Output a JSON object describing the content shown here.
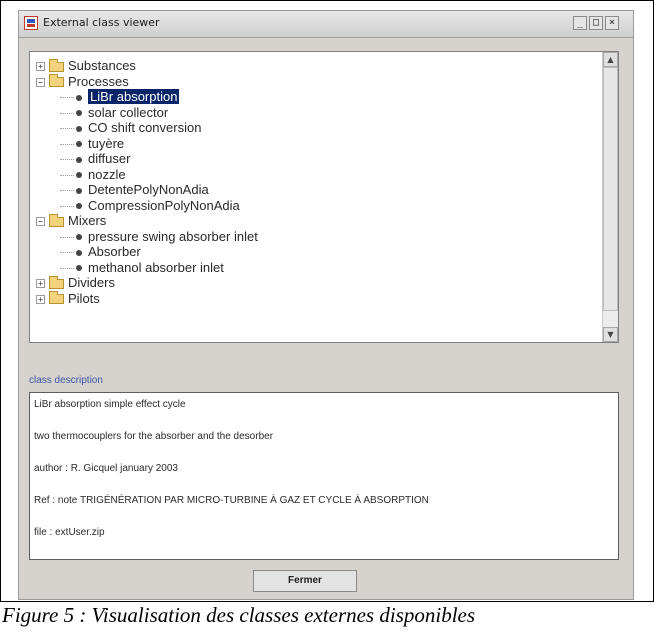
{
  "window": {
    "title": "External class viewer",
    "controls": {
      "minimize": "_",
      "maximize": "□",
      "close": "×"
    }
  },
  "tree": {
    "groups": [
      {
        "label": "Substances",
        "expanded": false,
        "expander": "+"
      },
      {
        "label": "Processes",
        "expanded": true,
        "expander": "−"
      },
      {
        "label": "Mixers",
        "expanded": true,
        "expander": "−"
      },
      {
        "label": "Dividers",
        "expanded": false,
        "expander": "+"
      },
      {
        "label": "Pilots",
        "expanded": false,
        "expander": "+"
      }
    ],
    "processes": [
      "LiBr absorption",
      "solar collector",
      "CO shift conversion",
      "tuyère",
      "diffuser",
      "nozzle",
      "DetentePolyNonAdia",
      "CompressionPolyNonAdia"
    ],
    "mixers": [
      "pressure swing absorber inlet",
      "Absorber",
      "methanol absorber inlet"
    ],
    "selected_item": "LiBr absorption",
    "scroll": {
      "up_arrow": "▲",
      "down_arrow": "▼"
    }
  },
  "description": {
    "label": "class description",
    "lines": [
      "LiBr absorption simple effect cycle",
      "two thermocouplers for the absorber and the desorber",
      "author : R. Gicquel  january 2003",
      "Ref : note TRIGÉNÉRATION PAR MICRO-TURBINE À GAZ ET CYCLE À ABSORPTION",
      "file : extUser.zip"
    ]
  },
  "buttons": {
    "close": "Fermer"
  },
  "caption": "Figure 5 : Visualisation des classes externes disponibles",
  "colors": {
    "selection": "#0a246a",
    "label_accent": "#3a55a5",
    "window_bg": "#d6d3ce"
  }
}
